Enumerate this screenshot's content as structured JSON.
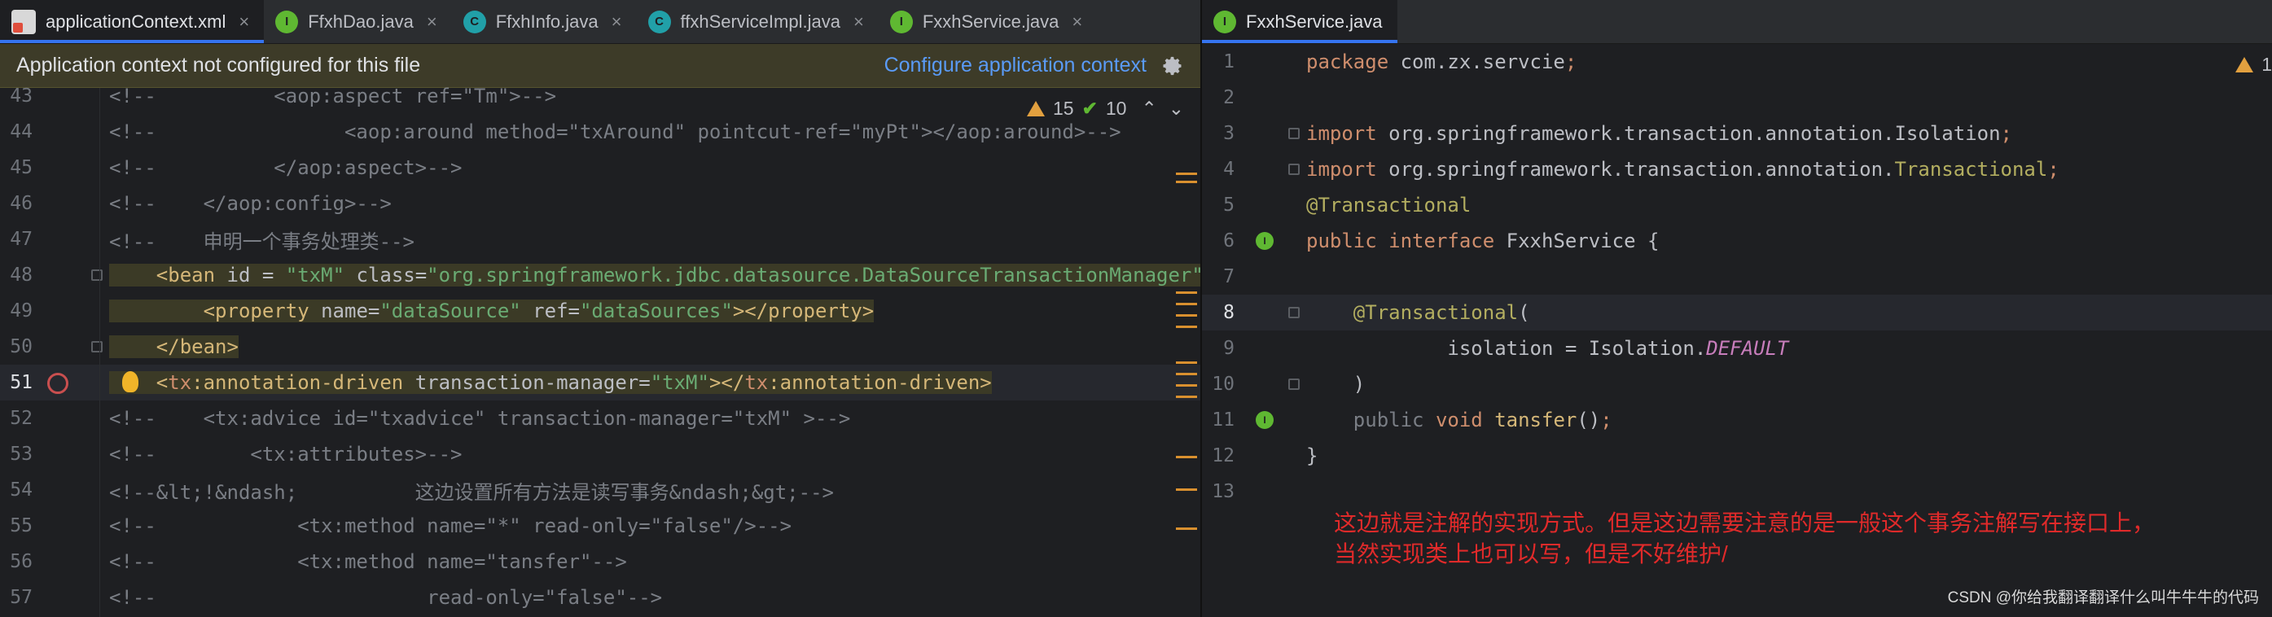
{
  "left_tabs": [
    {
      "label": "applicationContext.xml",
      "icon": "xml-file-icon"
    },
    {
      "label": "FfxhDao.java",
      "icon": "I"
    },
    {
      "label": "FfxhInfo.java",
      "icon": "C"
    },
    {
      "label": "ffxhServiceImpl.java",
      "icon": "C"
    },
    {
      "label": "FxxhService.java",
      "icon": "I"
    }
  ],
  "right_tabs": [
    {
      "label": "FxxhService.java",
      "icon": "I"
    }
  ],
  "banner": {
    "message": "Application context not configured for this file",
    "link": "Configure application context",
    "icon": "gear-icon"
  },
  "left_inspection": {
    "warnings": "15",
    "ok": "10"
  },
  "right_inspection": {
    "warnings": "1"
  },
  "left_code": {
    "lines": [
      {
        "n": "43",
        "parts": [
          [
            "c",
            "<!--          <aop:aspect ref=\"Tm\">-->"
          ]
        ]
      },
      {
        "n": "44",
        "parts": [
          [
            "c",
            "<!--                <aop:around method=\"txAround\" pointcut-ref=\"myPt\"></aop:around>-->"
          ]
        ]
      },
      {
        "n": "45",
        "parts": [
          [
            "c",
            "<!--          </aop:aspect>-->"
          ]
        ]
      },
      {
        "n": "46",
        "parts": [
          [
            "c",
            "<!--    </aop:config>-->"
          ]
        ]
      },
      {
        "n": "47",
        "parts": [
          [
            "c",
            "<!--    申明一个事务处理类-->"
          ]
        ]
      },
      {
        "n": "48",
        "parts": [
          [
            "tg",
            "    <bean "
          ],
          [
            "at",
            "id"
          ],
          [
            "pl",
            " = "
          ],
          [
            "st",
            "\"txM\""
          ],
          [
            "at",
            " class"
          ],
          [
            "pl",
            "="
          ],
          [
            "st",
            "\"org.springframework.jdbc.datasource.DataSourceTransactionManager\">"
          ]
        ]
      },
      {
        "n": "49",
        "parts": [
          [
            "tg",
            "        <property "
          ],
          [
            "at",
            "name"
          ],
          [
            "pl",
            "="
          ],
          [
            "st",
            "\"dataSource\""
          ],
          [
            "at",
            " ref"
          ],
          [
            "pl",
            "="
          ],
          [
            "st",
            "\"dataSources\""
          ],
          [
            "tg",
            "></property>"
          ]
        ]
      },
      {
        "n": "50",
        "parts": [
          [
            "tg",
            "    </bean>"
          ]
        ]
      },
      {
        "n": "51",
        "parts": [
          [
            "tg",
            "    <"
          ],
          [
            "kw",
            "tx"
          ],
          [
            "tg",
            ":annotation-driven "
          ],
          [
            "at",
            "transaction-manager"
          ],
          [
            "pl",
            "="
          ],
          [
            "st",
            "\"txM\""
          ],
          [
            "tg",
            "></"
          ],
          [
            "kw",
            "tx"
          ],
          [
            "tg",
            ":annotation-driven>"
          ]
        ]
      },
      {
        "n": "52",
        "parts": [
          [
            "c",
            "<!--    <tx:advice id=\"txadvice\" transaction-manager=\"txM\" >-->"
          ]
        ]
      },
      {
        "n": "53",
        "parts": [
          [
            "c",
            "<!--        <tx:attributes>-->"
          ]
        ]
      },
      {
        "n": "54",
        "parts": [
          [
            "c",
            "<!--&lt;!&ndash;          这边设置所有方法是读写事务&ndash;&gt;-->"
          ]
        ]
      },
      {
        "n": "55",
        "parts": [
          [
            "c",
            "<!--            <tx:method name=\"*\" read-only=\"false\"/>-->"
          ]
        ]
      },
      {
        "n": "56",
        "parts": [
          [
            "c",
            "<!--            <tx:method name=\"tansfer\"-->"
          ]
        ]
      },
      {
        "n": "57",
        "parts": [
          [
            "c",
            "<!--                       read-only=\"false\"-->"
          ]
        ]
      }
    ]
  },
  "right_code": {
    "lines": [
      {
        "n": "1",
        "parts": [
          [
            "kw",
            "package "
          ],
          [
            "pl",
            "com.zx.servcie"
          ],
          [
            "kw",
            ";"
          ]
        ]
      },
      {
        "n": "2",
        "parts": []
      },
      {
        "n": "3",
        "parts": [
          [
            "kw",
            "import "
          ],
          [
            "pl",
            "org.springframework.transaction.annotation.Isolation"
          ],
          [
            "kw",
            ";"
          ]
        ]
      },
      {
        "n": "4",
        "parts": [
          [
            "kw",
            "import "
          ],
          [
            "pl",
            "org.springframework.transaction.annotation."
          ],
          [
            "an",
            "Transactional"
          ],
          [
            "kw",
            ";"
          ]
        ]
      },
      {
        "n": "5",
        "parts": [
          [
            "an",
            "@Transactional"
          ]
        ]
      },
      {
        "n": "6",
        "parts": [
          [
            "kw",
            "public interface "
          ],
          [
            "pl",
            "FxxhService {"
          ]
        ]
      },
      {
        "n": "7",
        "parts": []
      },
      {
        "n": "8",
        "parts": [
          [
            "pl",
            "    "
          ],
          [
            "an",
            "@Transactional"
          ],
          [
            "pl",
            "("
          ]
        ]
      },
      {
        "n": "9",
        "parts": [
          [
            "pl",
            "            isolation = Isolation."
          ],
          [
            "it",
            "DEFAULT"
          ]
        ]
      },
      {
        "n": "10",
        "parts": [
          [
            "pl",
            "    )"
          ]
        ]
      },
      {
        "n": "11",
        "parts": [
          [
            "pl",
            "    "
          ],
          [
            "c",
            "public "
          ],
          [
            "kw",
            "void "
          ],
          [
            "tg",
            "tansfer"
          ],
          [
            "pl",
            "()"
          ],
          [
            "kw",
            ";"
          ]
        ]
      },
      {
        "n": "12",
        "parts": [
          [
            "pl",
            "}"
          ]
        ]
      },
      {
        "n": "13",
        "parts": []
      }
    ]
  },
  "annotation_note": "这边就是注解的实现方式。但是这边需要注意的是一般这个事务注解写在接口上，\n当然实现类上也可以写，但是不好维护/",
  "watermark": "CSDN @你给我翻译翻译什么叫牛牛牛的代码"
}
